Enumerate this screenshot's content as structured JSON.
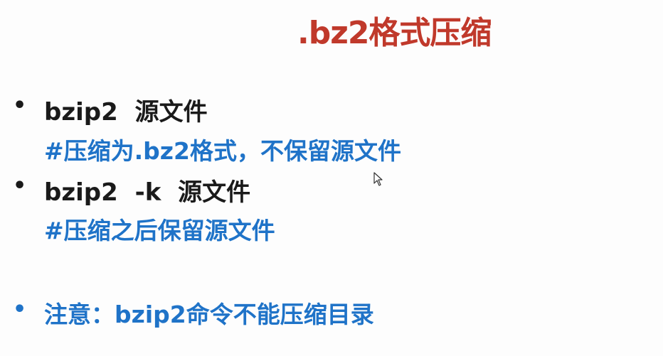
{
  "slide": {
    "title": ".bz2格式压缩",
    "items": [
      {
        "command": "bzip2  源文件",
        "comment": "#压缩为.bz2格式，不保留源文件"
      },
      {
        "command": "bzip2  -k  源文件",
        "comment": "#压缩之后保留源文件"
      }
    ],
    "note": "注意：bzip2命令不能压缩目录",
    "bullet_glyph": "•"
  },
  "colors": {
    "title": "#c0392b",
    "text": "#1a1a1a",
    "comment": "#1f73c8"
  },
  "icons": {
    "cursor": "mouse-pointer-icon"
  }
}
